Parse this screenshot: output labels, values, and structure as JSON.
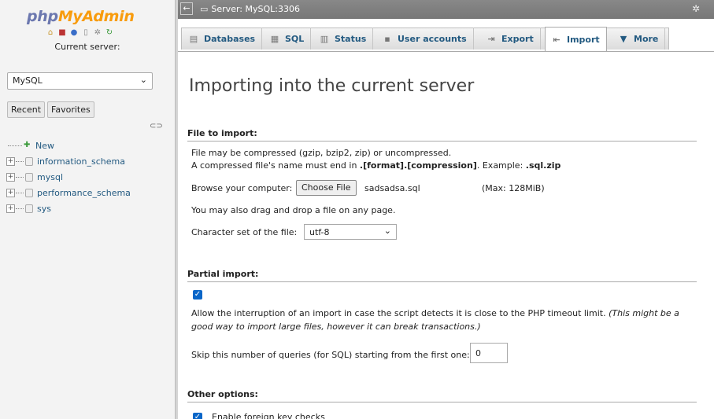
{
  "nav": {
    "logo_part1": "php",
    "logo_part2": "MyAdmin",
    "current_server_label": "Current server:",
    "server_select_value": "MySQL",
    "tabs": [
      "Recent",
      "Favorites"
    ],
    "tree": [
      {
        "label": "New"
      },
      {
        "label": "information_schema"
      },
      {
        "label": "mysql"
      },
      {
        "label": "performance_schema"
      },
      {
        "label": "sys"
      }
    ]
  },
  "topbar": {
    "server_label": "Server: MySQL:3306"
  },
  "tabs": [
    {
      "label": "Databases",
      "icon": "database-icon"
    },
    {
      "label": "SQL",
      "icon": "sql-icon"
    },
    {
      "label": "Status",
      "icon": "status-icon"
    },
    {
      "label": "User accounts",
      "icon": "users-icon"
    },
    {
      "label": "Export",
      "icon": "export-icon"
    },
    {
      "label": "Import",
      "icon": "import-icon"
    },
    {
      "label": "More",
      "icon": "chevron-down-icon"
    }
  ],
  "main": {
    "title": "Importing into the current server",
    "file_to_import": {
      "heading": "File to import:",
      "line1": "File may be compressed (gzip, bzip2, zip) or uncompressed.",
      "line2_prefix": "A compressed file's name must end in ",
      "line2_bold": ".[format].[compression]",
      "line2_mid": ". Example: ",
      "line2_example": ".sql.zip",
      "browse_label": "Browse your computer:",
      "choose_button": "Choose File",
      "chosen_file": "sadsadsa.sql",
      "max_size": "(Max: 128MiB)",
      "drag_hint": "You may also drag and drop a file on any page.",
      "charset_label": "Character set of the file:",
      "charset_value": "utf-8"
    },
    "partial_import": {
      "heading": "Partial import:",
      "allow_text": "Allow the interruption of an import in case the script detects it is close to the PHP timeout limit.",
      "allow_note": "(This might be a good way to import large files, however it can break transactions.)",
      "skip_label": "Skip this number of queries (for SQL) starting from the first one:",
      "skip_value": "0"
    },
    "other_options": {
      "heading": "Other options:",
      "fk_label": "Enable foreign key checks"
    }
  }
}
